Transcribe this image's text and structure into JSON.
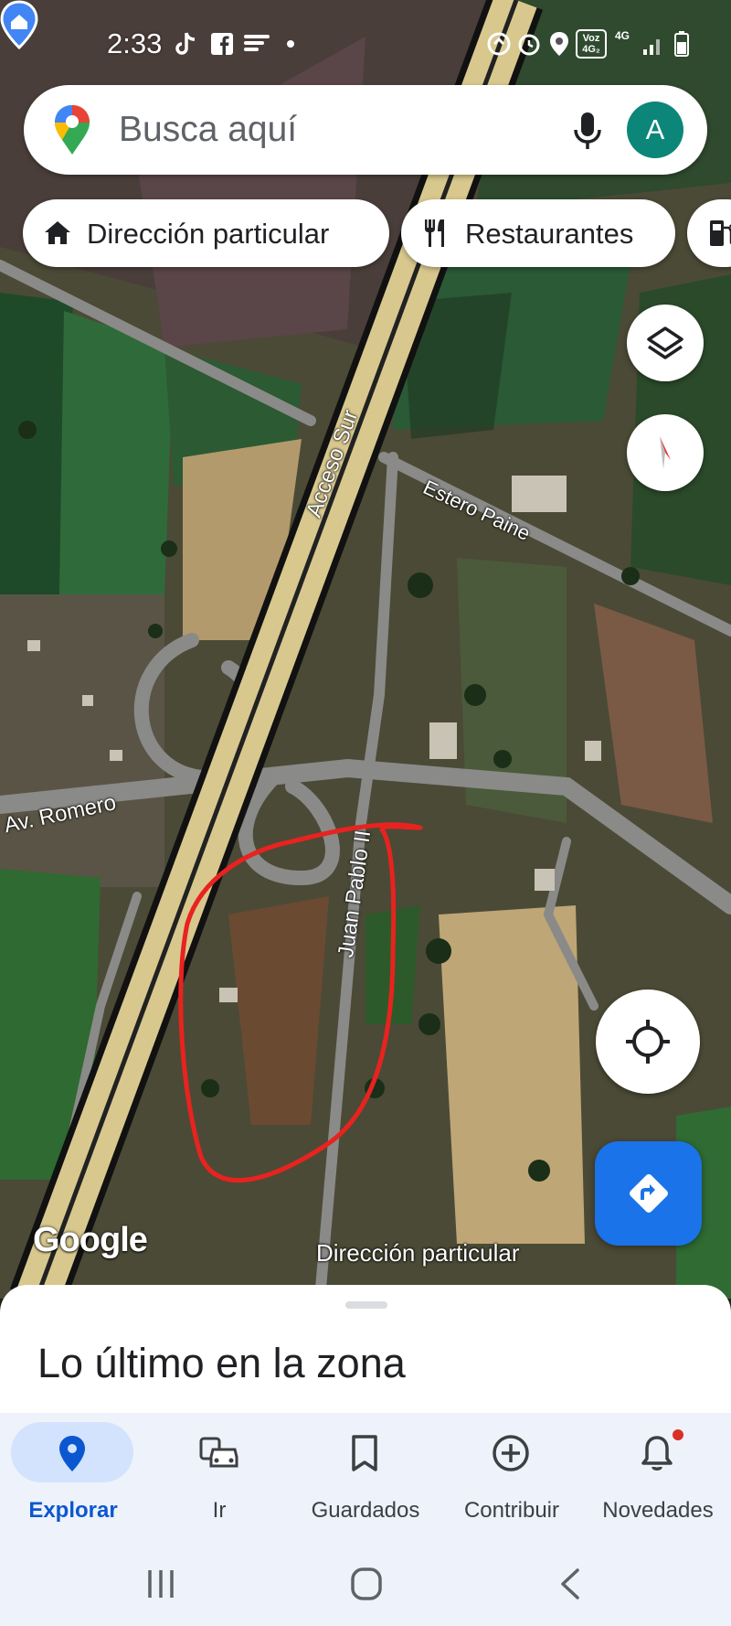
{
  "status_bar": {
    "time": "2:33",
    "net_badge_line1": "Voz",
    "net_badge_line2": "4G₂",
    "network_type": "4G",
    "icons": [
      "tiktok-icon",
      "facebook-icon",
      "notification-icon",
      "dot-icon",
      "recycle-icon",
      "alarm-icon",
      "location-icon",
      "signal-icon",
      "battery-icon"
    ]
  },
  "search": {
    "placeholder": "Busca aquí",
    "avatar_letter": "A",
    "avatar_color": "#0b8678"
  },
  "chips": [
    {
      "label": "Dirección particular",
      "icon": "home-icon"
    },
    {
      "label": "Restaurantes",
      "icon": "restaurant-icon"
    },
    {
      "label": "",
      "icon": "gas-station-icon"
    }
  ],
  "map": {
    "labels": {
      "highway": "Acceso Sur",
      "estero": "Estero Paine",
      "av_romero": "Av. Romero",
      "juan_pablo": "Juan Pablo II"
    },
    "attribution": "Google",
    "saved_place_label": "Dirección particular",
    "annotation_color": "#e8231f"
  },
  "sheet": {
    "title": "Lo último en la zona"
  },
  "nav": {
    "items": [
      {
        "label": "Explorar",
        "icon": "explore-pin-icon",
        "active": true
      },
      {
        "label": "Ir",
        "icon": "commute-icon",
        "active": false
      },
      {
        "label": "Guardados",
        "icon": "bookmark-icon",
        "active": false
      },
      {
        "label": "Contribuir",
        "icon": "add-circle-icon",
        "active": false
      },
      {
        "label": "Novedades",
        "icon": "bell-icon",
        "active": false
      }
    ],
    "accent": "#0b57d0"
  }
}
